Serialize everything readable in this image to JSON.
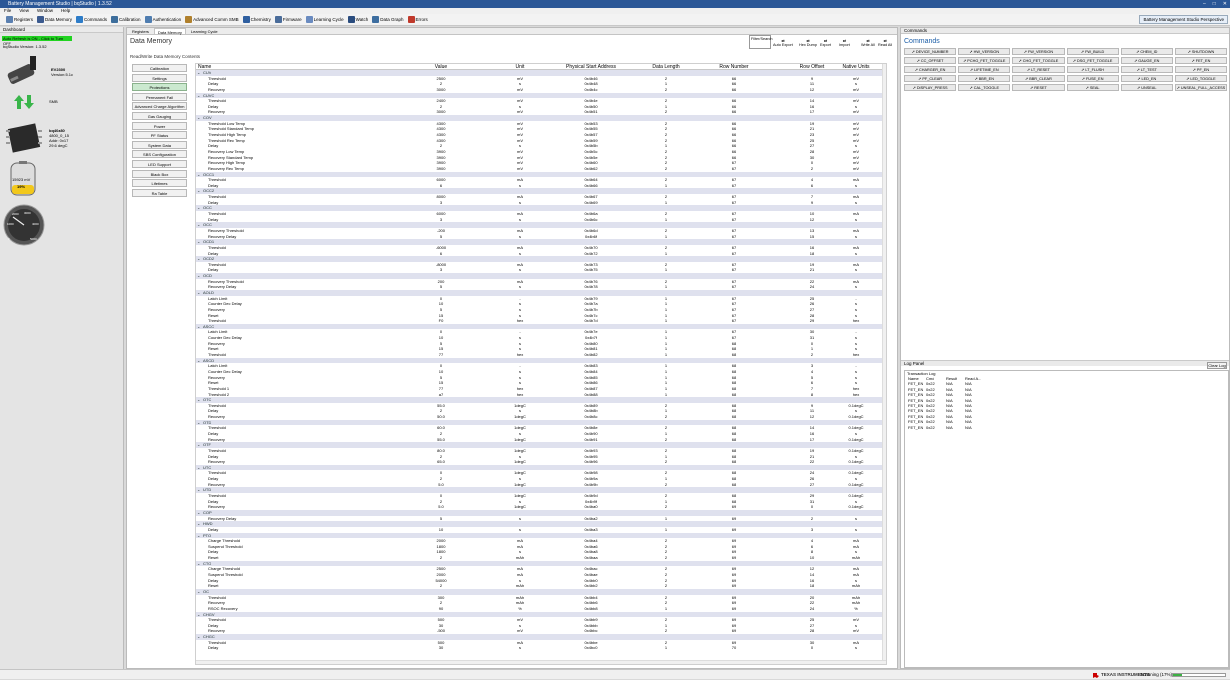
{
  "app": {
    "title": "Battery Management Studio | bqStudio | 1.3.52",
    "window_buttons": [
      "–",
      "□",
      "✕"
    ],
    "menu": [
      "File",
      "View",
      "Window",
      "Help"
    ],
    "toolbar": [
      {
        "label": "Registers",
        "icon": "registers-icon",
        "color": "#5a7fb0"
      },
      {
        "label": "Data Memory",
        "icon": "data-memory-icon",
        "color": "#3b5a8f"
      },
      {
        "label": "Commands",
        "icon": "commands-icon",
        "color": "#2d7cc8"
      },
      {
        "label": "Calibration",
        "icon": "calibration-icon",
        "color": "#3d6e9c"
      },
      {
        "label": "Authentication",
        "icon": "authentication-icon",
        "color": "#4f7db0"
      },
      {
        "label": "Advanced Comm SMB",
        "icon": "advanced-comm-icon",
        "color": "#b0802c"
      },
      {
        "label": "Chemistry",
        "icon": "chemistry-icon",
        "color": "#2f5fa0"
      },
      {
        "label": "Firmware",
        "icon": "firmware-icon",
        "color": "#4a6c9a"
      },
      {
        "label": "Learning Cycle",
        "icon": "learning-cycle-icon",
        "color": "#6a8bc0"
      },
      {
        "label": "Watch",
        "icon": "watch-icon",
        "color": "#2a4c7e"
      },
      {
        "label": "Data Graph",
        "icon": "data-graph-icon",
        "color": "#3d6ea0"
      },
      {
        "label": "Errors",
        "icon": "errors-icon",
        "color": "#c0392b"
      }
    ],
    "perspective": "Battery Management Studio Perspective"
  },
  "dashboard": {
    "title": "Dashboard",
    "autorefresh": "Auto Refresh is ON - Click to Turn OFF",
    "version": "bqStudio Version: 1.3.52",
    "ev_name": "EV2300",
    "ev_version": "Version:5.1c",
    "smb": "SMB",
    "device": "bq40z80",
    "fw": "4800_0_15",
    "addr": "Addr: 0x17",
    "temp": "29.6 degC",
    "voltage": "15923 mV",
    "soc": "19%",
    "gauge_ticks": [
      "0",
      "1000",
      "2000",
      "3000",
      "4000",
      "5000"
    ]
  },
  "center": {
    "tabs": [
      "Registers",
      "Data Memory",
      "Learning Cycle"
    ],
    "title": "Data Memory",
    "subtitle": "Read/Write Data Memory Contents",
    "filter": "Filter/Search",
    "actions": [
      "Auto Export",
      "Hex Dump",
      "Export",
      "Import",
      "Write All",
      "Read All"
    ],
    "categories": [
      "Calibration",
      "Settings",
      "Protections",
      "Permanent Fail",
      "Advanced Charge Algorithm",
      "Gas Gauging",
      "Power",
      "PF Status",
      "System Data",
      "SBS Configuration",
      "LED Support",
      "Black Box",
      "Lifetimes",
      "Ra Table"
    ],
    "columns": [
      "Name",
      "Value",
      "Unit",
      "Physical Start Address",
      "Data Length",
      "Row Number",
      "Row Offset",
      "Native Units"
    ],
    "rows": [
      [
        "g",
        "CUV"
      ],
      [
        "Threshold",
        "2500",
        "mV",
        "0x4b46",
        "2",
        "66",
        "9",
        "mV"
      ],
      [
        "Delay",
        "2",
        "s",
        "0x4b48",
        "1",
        "66",
        "11",
        "s"
      ],
      [
        "Recovery",
        "3000",
        "mV",
        "0x4b4c",
        "2",
        "66",
        "12",
        "mV"
      ],
      [
        "g",
        "CUVC"
      ],
      [
        "Threshold",
        "2400",
        "mV",
        "0x4b4e",
        "2",
        "66",
        "14",
        "mV"
      ],
      [
        "Delay",
        "2",
        "s",
        "0x4b50",
        "1",
        "66",
        "16",
        "s"
      ],
      [
        "Recovery",
        "3000",
        "mV",
        "0x4b51",
        "2",
        "66",
        "17",
        "mV"
      ],
      [
        "g",
        "COV"
      ],
      [
        "Threshold Low Temp",
        "4300",
        "mV",
        "0x4b53",
        "2",
        "66",
        "19",
        "mV"
      ],
      [
        "Threshold Standard Temp",
        "4300",
        "mV",
        "0x4b55",
        "2",
        "66",
        "21",
        "mV"
      ],
      [
        "Threshold High Temp",
        "4300",
        "mV",
        "0x4b57",
        "2",
        "66",
        "23",
        "mV"
      ],
      [
        "Threshold Rec Temp",
        "4300",
        "mV",
        "0x4b59",
        "2",
        "66",
        "25",
        "mV"
      ],
      [
        "Delay",
        "2",
        "s",
        "0x4b5b",
        "1",
        "66",
        "27",
        "s"
      ],
      [
        "Recovery Low Temp",
        "3900",
        "mV",
        "0x4b5c",
        "2",
        "66",
        "28",
        "mV"
      ],
      [
        "Recovery Standard Temp",
        "3900",
        "mV",
        "0x4b5e",
        "2",
        "66",
        "30",
        "mV"
      ],
      [
        "Recovery High Temp",
        "3900",
        "mV",
        "0x4b60",
        "2",
        "67",
        "0",
        "mV"
      ],
      [
        "Recovery Rec Temp",
        "3900",
        "mV",
        "0x4b62",
        "2",
        "67",
        "2",
        "mV"
      ],
      [
        "g",
        "OCC1"
      ],
      [
        "Threshold",
        "6000",
        "mA",
        "0x4b64",
        "2",
        "67",
        "4",
        "mA"
      ],
      [
        "Delay",
        "6",
        "s",
        "0x4b66",
        "1",
        "67",
        "6",
        "s"
      ],
      [
        "g",
        "OCC2"
      ],
      [
        "Threshold",
        "8000",
        "mA",
        "0x4b67",
        "2",
        "67",
        "7",
        "mA"
      ],
      [
        "Delay",
        "3",
        "s",
        "0x4b69",
        "1",
        "67",
        "9",
        "s"
      ],
      [
        "g",
        "OCC"
      ],
      [
        "Threshold",
        "6000",
        "mA",
        "0x4b6a",
        "2",
        "67",
        "10",
        "mA"
      ],
      [
        "Delay",
        "3",
        "s",
        "0x4b6c",
        "1",
        "67",
        "12",
        "s"
      ],
      [
        "g",
        "OCC"
      ],
      [
        "Recovery Threshold",
        "-200",
        "mA",
        "0x4b6d",
        "2",
        "67",
        "13",
        "mA"
      ],
      [
        "Recovery Delay",
        "5",
        "s",
        "0x4b6f",
        "1",
        "67",
        "15",
        "s"
      ],
      [
        "g",
        "OCD1"
      ],
      [
        "Threshold",
        "-6000",
        "mA",
        "0x4b70",
        "2",
        "67",
        "16",
        "mA"
      ],
      [
        "Delay",
        "6",
        "s",
        "0x4b72",
        "1",
        "67",
        "18",
        "s"
      ],
      [
        "g",
        "OCD2"
      ],
      [
        "Threshold",
        "-8000",
        "mA",
        "0x4b73",
        "2",
        "67",
        "19",
        "mA"
      ],
      [
        "Delay",
        "3",
        "s",
        "0x4b75",
        "1",
        "67",
        "21",
        "s"
      ],
      [
        "g",
        "OCD"
      ],
      [
        "Recovery Threshold",
        "200",
        "mA",
        "0x4b76",
        "2",
        "67",
        "22",
        "mA"
      ],
      [
        "Recovery Delay",
        "5",
        "s",
        "0x4b78",
        "1",
        "67",
        "24",
        "s"
      ],
      [
        "g",
        "AOLD"
      ],
      [
        "Latch Limit",
        "0",
        "-",
        "0x4b79",
        "1",
        "67",
        "25",
        "-"
      ],
      [
        "Counter Dec Delay",
        "10",
        "s",
        "0x4b7a",
        "1",
        "67",
        "26",
        "s"
      ],
      [
        "Recovery",
        "5",
        "s",
        "0x4b7b",
        "1",
        "67",
        "27",
        "s"
      ],
      [
        "Reset",
        "15",
        "s",
        "0x4b7c",
        "1",
        "67",
        "28",
        "s"
      ],
      [
        "Threshold",
        "F0",
        "hex",
        "0x4b7d",
        "1",
        "67",
        "29",
        "hex"
      ],
      [
        "g",
        "ASCC"
      ],
      [
        "Latch Limit",
        "0",
        "-",
        "0x4b7e",
        "1",
        "67",
        "30",
        "-"
      ],
      [
        "Counter Dec Delay",
        "10",
        "s",
        "0x4b7f",
        "1",
        "67",
        "31",
        "s"
      ],
      [
        "Recovery",
        "5",
        "s",
        "0x4b80",
        "1",
        "68",
        "0",
        "s"
      ],
      [
        "Reset",
        "15",
        "s",
        "0x4b81",
        "1",
        "68",
        "1",
        "s"
      ],
      [
        "Threshold",
        "77",
        "hex",
        "0x4b82",
        "1",
        "68",
        "2",
        "hex"
      ],
      [
        "g",
        "ASCD"
      ],
      [
        "Latch Limit",
        "0",
        "-",
        "0x4b83",
        "1",
        "68",
        "3",
        "-"
      ],
      [
        "Counter Dec Delay",
        "10",
        "s",
        "0x4b84",
        "1",
        "68",
        "4",
        "s"
      ],
      [
        "Recovery",
        "5",
        "s",
        "0x4b85",
        "1",
        "68",
        "5",
        "s"
      ],
      [
        "Reset",
        "15",
        "s",
        "0x4b86",
        "1",
        "68",
        "6",
        "s"
      ],
      [
        "Threshold 1",
        "77",
        "hex",
        "0x4b87",
        "1",
        "68",
        "7",
        "hex"
      ],
      [
        "Threshold 2",
        "a7",
        "hex",
        "0x4b88",
        "1",
        "68",
        "8",
        "hex"
      ],
      [
        "g",
        "OTC"
      ],
      [
        "Threshold",
        "55.0",
        "1degC",
        "0x4b89",
        "2",
        "68",
        "9",
        "0.1degC"
      ],
      [
        "Delay",
        "2",
        "s",
        "0x4b8b",
        "1",
        "68",
        "11",
        "s"
      ],
      [
        "Recovery",
        "50.0",
        "1degC",
        "0x4b8c",
        "2",
        "68",
        "12",
        "0.1degC"
      ],
      [
        "g",
        "OTD"
      ],
      [
        "Threshold",
        "60.0",
        "1degC",
        "0x4b8e",
        "2",
        "68",
        "14",
        "0.1degC"
      ],
      [
        "Delay",
        "2",
        "s",
        "0x4b90",
        "1",
        "68",
        "16",
        "s"
      ],
      [
        "Recovery",
        "55.0",
        "1degC",
        "0x4b91",
        "2",
        "68",
        "17",
        "0.1degC"
      ],
      [
        "g",
        "OTF"
      ],
      [
        "Threshold",
        "80.0",
        "1degC",
        "0x4b93",
        "2",
        "68",
        "19",
        "0.1degC"
      ],
      [
        "Delay",
        "2",
        "s",
        "0x4b95",
        "1",
        "68",
        "21",
        "s"
      ],
      [
        "Recovery",
        "65.0",
        "1degC",
        "0x4b96",
        "2",
        "68",
        "22",
        "0.1degC"
      ],
      [
        "g",
        "UTC"
      ],
      [
        "Threshold",
        "0",
        "1degC",
        "0x4b98",
        "2",
        "68",
        "24",
        "0.1degC"
      ],
      [
        "Delay",
        "2",
        "s",
        "0x4b9a",
        "1",
        "68",
        "26",
        "s"
      ],
      [
        "Recovery",
        "5.0",
        "1degC",
        "0x4b9b",
        "2",
        "68",
        "27",
        "0.1degC"
      ],
      [
        "g",
        "UTD"
      ],
      [
        "Threshold",
        "0",
        "1degC",
        "0x4b9d",
        "2",
        "68",
        "29",
        "0.1degC"
      ],
      [
        "Delay",
        "2",
        "s",
        "0x4b9f",
        "1",
        "68",
        "31",
        "s"
      ],
      [
        "Recovery",
        "5.0",
        "1degC",
        "0x4ba0",
        "2",
        "69",
        "0",
        "0.1degC"
      ],
      [
        "g",
        "COP"
      ],
      [
        "Recovery Delay",
        "5",
        "s",
        "0x4ba2",
        "1",
        "69",
        "2",
        "s"
      ],
      [
        "g",
        "HWD"
      ],
      [
        "Delay",
        "10",
        "s",
        "0x4ba3",
        "1",
        "69",
        "3",
        "s"
      ],
      [
        "g",
        "PTO"
      ],
      [
        "Charge Threshold",
        "2000",
        "mA",
        "0x4ba4",
        "2",
        "69",
        "4",
        "mA"
      ],
      [
        "Suspend Threshold",
        "1800",
        "mA",
        "0x4ba6",
        "2",
        "69",
        "6",
        "mA"
      ],
      [
        "Delay",
        "1800",
        "s",
        "0x4ba8",
        "2",
        "69",
        "8",
        "s"
      ],
      [
        "Reset",
        "2",
        "mAh",
        "0x4baa",
        "2",
        "69",
        "10",
        "mAh"
      ],
      [
        "g",
        "CTO"
      ],
      [
        "Charge Threshold",
        "2500",
        "mA",
        "0x4bac",
        "2",
        "69",
        "12",
        "mA"
      ],
      [
        "Suspend Threshold",
        "2000",
        "mA",
        "0x4bae",
        "2",
        "69",
        "14",
        "mA"
      ],
      [
        "Delay",
        "54000",
        "s",
        "0x4bb0",
        "2",
        "69",
        "16",
        "s"
      ],
      [
        "Reset",
        "2",
        "mAh",
        "0x4bb2",
        "2",
        "69",
        "18",
        "mAh"
      ],
      [
        "g",
        "OC"
      ],
      [
        "Threshold",
        "300",
        "mAh",
        "0x4bb4",
        "2",
        "69",
        "20",
        "mAh"
      ],
      [
        "Recovery",
        "2",
        "mAh",
        "0x4bb6",
        "2",
        "69",
        "22",
        "mAh"
      ],
      [
        "RSOC Recovery",
        "90",
        "%",
        "0x4bb8",
        "1",
        "69",
        "24",
        "%"
      ],
      [
        "g",
        "CHGV"
      ],
      [
        "Threshold",
        "500",
        "mV",
        "0x4bb9",
        "2",
        "69",
        "25",
        "mV"
      ],
      [
        "Delay",
        "30",
        "s",
        "0x4bbb",
        "1",
        "69",
        "27",
        "s"
      ],
      [
        "Recovery",
        "-500",
        "mV",
        "0x4bbc",
        "2",
        "69",
        "28",
        "mV"
      ],
      [
        "g",
        "CHGC"
      ],
      [
        "Threshold",
        "500",
        "mA",
        "0x4bbe",
        "2",
        "69",
        "30",
        "mA"
      ],
      [
        "Delay",
        "30",
        "s",
        "0x4bc0",
        "1",
        "70",
        "0",
        "s"
      ]
    ]
  },
  "commands": {
    "panel": "Commands",
    "title": "Commands",
    "items": [
      "DEVICE_NUMBER",
      "HW_VERSION",
      "FW_VERSION",
      "FW_BUILD",
      "CHEM_ID",
      "SHUTDOWN",
      "CC_OFFSET",
      "PCHG_FET_TOGGLE",
      "CHG_FET_TOGGLE",
      "DSG_FET_TOGGLE",
      "GAUGE_EN",
      "FET_EN",
      "CHARGER_EN",
      "LIFETIME_EN",
      "LT_RESET",
      "LT_FLUSH",
      "LT_TEST",
      "PF_EN",
      "PF_CLEAR",
      "BBR_EN",
      "BBR_CLEAR",
      "FUSE_EN",
      "LED_EN",
      "LED_TOGGLE",
      "DISPLAY_PRESS",
      "CAL_TOGGLE",
      "RESET",
      "SEAL",
      "UNSEAL",
      "UNSEAL_FULL_ACCESS"
    ]
  },
  "log": {
    "title": "Log Panel",
    "clear": "Clear Log",
    "tx": "Transaction Log",
    "cols": [
      "Name",
      "Cmd",
      "Result",
      "Read A..."
    ],
    "rows": [
      [
        "FET_EN",
        "0x22",
        "N/A",
        "N/A"
      ],
      [
        "FET_EN",
        "0x22",
        "N/A",
        "N/A"
      ],
      [
        "FET_EN",
        "0x22",
        "N/A",
        "N/A"
      ],
      [
        "FET_EN",
        "0x22",
        "N/A",
        "N/A"
      ],
      [
        "FET_EN",
        "0x22",
        "N/A",
        "N/A"
      ],
      [
        "FET_EN",
        "0x22",
        "N/A",
        "N/A"
      ],
      [
        "FET_EN",
        "0x22",
        "N/A",
        "N/A"
      ],
      [
        "FET_EN",
        "0x22",
        "N/A",
        "N/A"
      ],
      [
        "FET_EN",
        "0x22",
        "N/A",
        "N/A"
      ]
    ]
  },
  "status": {
    "brand": "TEXAS INSTRUMENTS",
    "text": "Scanning (17%)"
  }
}
